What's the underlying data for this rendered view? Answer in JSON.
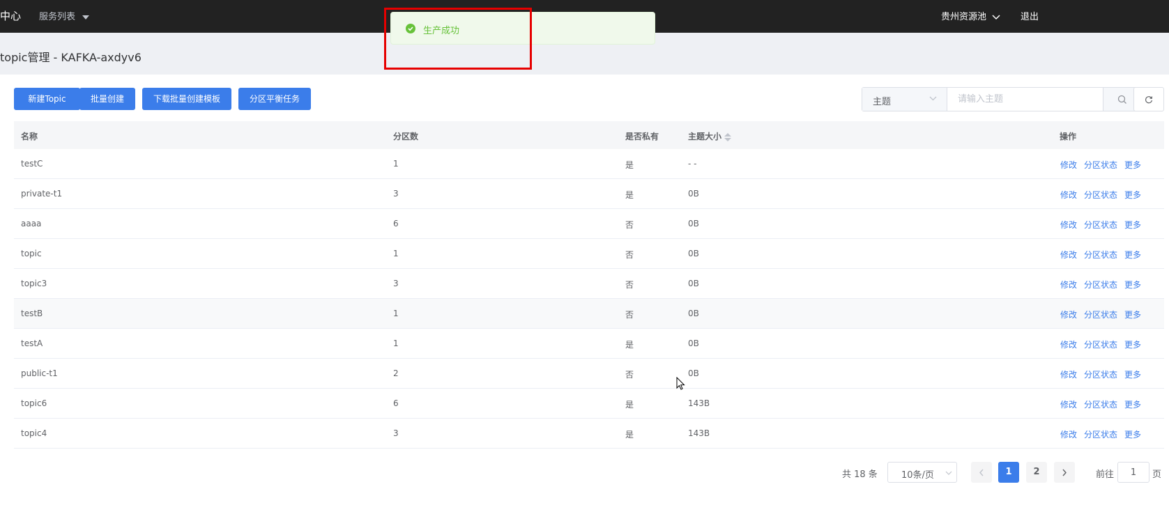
{
  "header": {
    "brand": "中心",
    "service_menu": "服务列表",
    "resource_pool": "贵州资源池",
    "logout": "退出"
  },
  "toast": {
    "message": "生产成功",
    "type": "success",
    "color": "#67c23a"
  },
  "page": {
    "title": "topic管理 - KAFKA-axdyv6"
  },
  "toolbar": {
    "new_topic": "新建Topic",
    "batch_create": "批量创建",
    "download_template": "下载批量创建模板",
    "partition_balance": "分区平衡任务"
  },
  "filter": {
    "select_value": "主题",
    "placeholder": "请输入主题"
  },
  "table": {
    "headers": {
      "name": "名称",
      "partitions": "分区数",
      "private": "是否私有",
      "size": "主题大小",
      "ops": "操作"
    },
    "op_labels": {
      "edit": "修改",
      "partition_status": "分区状态",
      "more": "更多"
    },
    "rows": [
      {
        "name": "testC",
        "partitions": "1",
        "private": "是",
        "size": "- -"
      },
      {
        "name": "private-t1",
        "partitions": "3",
        "private": "是",
        "size": "0B"
      },
      {
        "name": "aaaa",
        "partitions": "6",
        "private": "否",
        "size": "0B"
      },
      {
        "name": "topic",
        "partitions": "1",
        "private": "否",
        "size": "0B"
      },
      {
        "name": "topic3",
        "partitions": "3",
        "private": "否",
        "size": "0B"
      },
      {
        "name": "testB",
        "partitions": "1",
        "private": "否",
        "size": "0B"
      },
      {
        "name": "testA",
        "partitions": "1",
        "private": "是",
        "size": "0B"
      },
      {
        "name": "public-t1",
        "partitions": "2",
        "private": "否",
        "size": "0B"
      },
      {
        "name": "topic6",
        "partitions": "6",
        "private": "是",
        "size": "143B"
      },
      {
        "name": "topic4",
        "partitions": "3",
        "private": "是",
        "size": "143B"
      }
    ]
  },
  "pagination": {
    "total": "共 18 条",
    "page_size": "10条/页",
    "pages": [
      "1",
      "2"
    ],
    "current_page": "1",
    "goto_label": "前往",
    "goto_value": "1",
    "goto_suffix": "页"
  },
  "colors": {
    "primary": "#3b7dea",
    "topbar": "#222222",
    "highlight_box": "#e60000"
  }
}
